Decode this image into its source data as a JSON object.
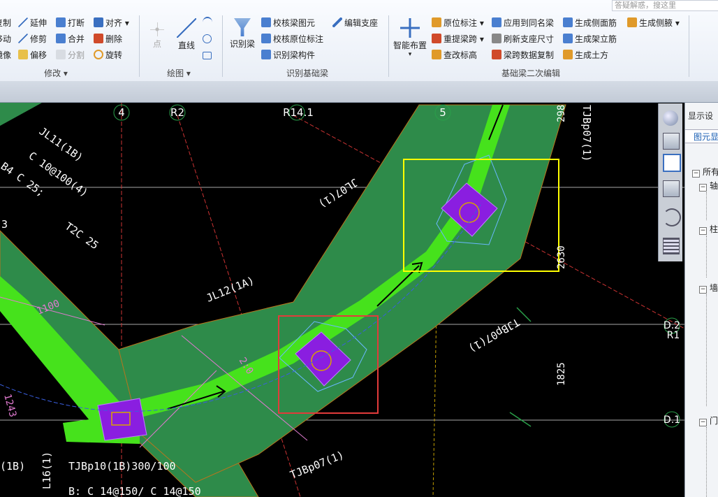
{
  "search": {
    "placeholder": "答疑解惑，搜这里"
  },
  "ribbon": {
    "modify_col1": [
      "复制",
      "移动",
      "镜像"
    ],
    "modify_col2": [
      "延伸",
      "修剪",
      "偏移"
    ],
    "modify_col3": [
      "打断",
      "合并",
      "分割"
    ],
    "modify_col4": [
      "对齐",
      "删除",
      "旋转"
    ],
    "draw": {
      "point": "点",
      "line": "直线"
    },
    "identify_beam": "识别梁",
    "recog": [
      "校核梁图元",
      "校核原位标注",
      "识别梁构件"
    ],
    "edit_support": "编辑支座",
    "smart_layout": "智能布置",
    "col_a": [
      "原位标注",
      "重提梁跨",
      "查改标高"
    ],
    "col_b": [
      "应用到同名梁",
      "刷新支座尺寸",
      "梁跨数据复制"
    ],
    "col_c": [
      "生成侧面筋",
      "生成架立筋",
      "生成土方"
    ],
    "col_d": "生成侧腋",
    "groups": {
      "modify": "修改",
      "draw": "绘图",
      "recog": "识别基础梁",
      "secondary": "基础梁二次编辑"
    }
  },
  "panel": {
    "title": "显示设",
    "tab": "图元显",
    "items": [
      "所有",
      "轴",
      "柱",
      "墙",
      "门"
    ]
  },
  "canvas": {
    "axes": {
      "a4": "4",
      "r2": "R2",
      "r14": "R14.1",
      "a5": "5"
    },
    "right_axes": {
      "d2": "D.2",
      "r1": "R1",
      "d1": "D.1"
    },
    "left_labels": [
      "JL11(1B)",
      "C 10@100(4)",
      "B4 C 25;",
      "T2C 25",
      "3"
    ],
    "dims": [
      "1100",
      "1243",
      "298",
      "2630",
      "1825"
    ],
    "beams": [
      "JL12(1A)",
      "JL07(1)",
      "TJBp07(1)",
      "TJBp07(1)",
      "TJBp07(1)"
    ],
    "bottom": [
      "TJBp10(1B)300/100",
      "B: C 14@150/ C 14@150",
      "L16(1)",
      "(1B)"
    ],
    "misc": "2:0"
  },
  "colors": {
    "beam_band": "#2e8b4a",
    "beam_core": "#46e21c",
    "column": "#8a1ee0",
    "highlight_yellow": "#ffff00",
    "highlight_red": "#e23b3b",
    "label_white": "#ffffff",
    "label_pink": "#e07ad0"
  }
}
